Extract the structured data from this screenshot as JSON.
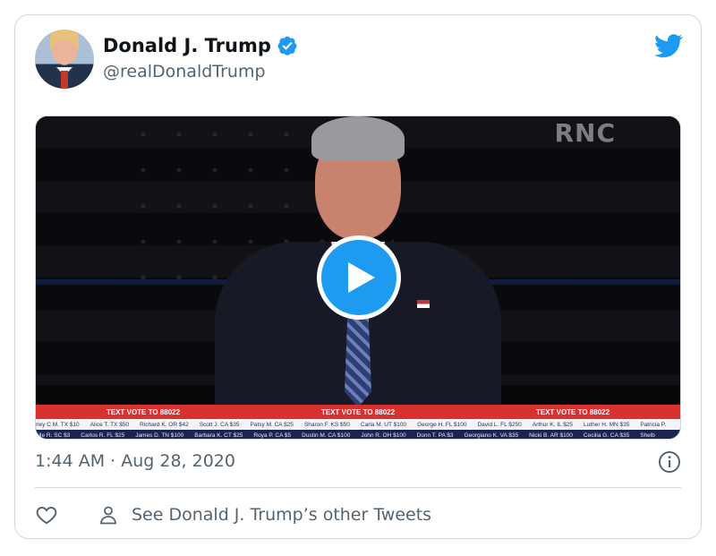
{
  "tweet": {
    "author": {
      "display_name": "Donald J. Trump",
      "handle": "@realDonaldTrump",
      "verified": true,
      "avatar_icon": "profile-photo"
    },
    "brand_icon": "twitter-bird-icon",
    "media": {
      "type": "video",
      "watermark": "RNC",
      "ticker": {
        "banners": [
          "TEXT VOTE TO 88022",
          "TEXT VOTE TO 88022",
          "TEXT VOTE TO 88022"
        ],
        "row1": [
          "rley C M. TX $10",
          "Alice T. TX $50",
          "Richard K. OR $42",
          "Scott J. CA $35",
          "Patsy M. CA $25",
          "Sharon F. KS $50",
          "Carla M. UT $100",
          "George H. FL $100",
          "David L. FL $250",
          "Arthur K. IL $25",
          "Luther H. MN $35",
          "Patricia P."
        ],
        "row2": [
          "elle R. SC $3",
          "Carlos R. FL $25",
          "James D. TN $100",
          "Barbara K. CT $25",
          "Roya P. CA $5",
          "Dustin M. CA $100",
          "John R. OH $100",
          "Donn T. PA $3",
          "Georgiano K. VA $35",
          "Nicki B. AR $100",
          "Cecilia G. CA $35",
          "Shelb"
        ]
      },
      "play_icon": "play-icon"
    },
    "timestamp": "1:44 AM · Aug 28, 2020",
    "actions": {
      "like_icon": "heart-icon",
      "see_other": "See Donald J. Trump’s other Tweets"
    },
    "colors": {
      "accent": "#1d9bf0",
      "text_secondary": "#536471",
      "border": "#cfd9de"
    }
  }
}
